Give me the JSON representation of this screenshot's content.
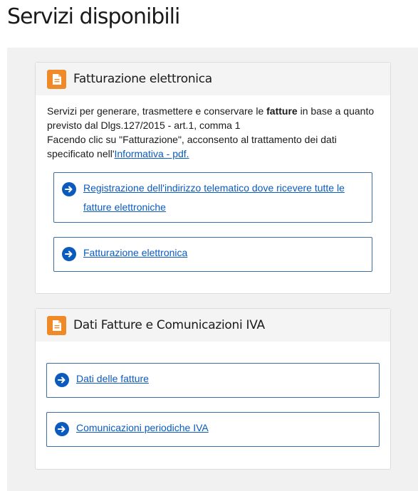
{
  "page": {
    "title": "Servizi disponibili"
  },
  "cards": [
    {
      "title": "Fatturazione elettronica",
      "icon": "document-icon",
      "description": {
        "part1": "Servizi per generare, trasmettere e conservare le ",
        "bold": "fatture",
        "part2": " in base a quanto previsto dal Dlgs.127/2015 - art.1, comma 1",
        "line2": "Facendo clic su \"Fatturazione\", acconsento al trattamento dei dati specificato nell'",
        "link": "Informativa - pdf."
      },
      "links": [
        {
          "label": "Registrazione dell'indirizzo telematico dove ricevere tutte le fatture elettroniche",
          "icon": "arrow-right-circle-icon"
        },
        {
          "label": "Fatturazione elettronica",
          "icon": "arrow-right-circle-icon"
        }
      ]
    },
    {
      "title": "Dati Fatture e Comunicazioni IVA",
      "icon": "document-icon",
      "links": [
        {
          "label": "Dati delle fatture",
          "icon": "arrow-right-circle-icon"
        },
        {
          "label": "Comunicazioni periodiche IVA",
          "icon": "arrow-right-circle-icon"
        }
      ]
    }
  ],
  "colors": {
    "accent_orange": "#f08a28",
    "link_blue": "#0b5bbf",
    "border_blue": "#3a6ea5",
    "panel_bg": "#f1f1f1"
  }
}
